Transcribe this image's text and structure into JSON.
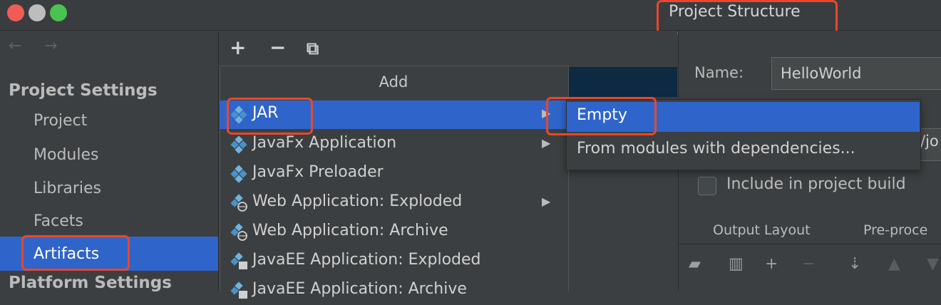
{
  "window": {
    "title": "Project Structure"
  },
  "sidebar": {
    "back_arrow": "←",
    "forward_arrow": "→",
    "project_settings_header": "Project Settings",
    "items": [
      {
        "label": "Project"
      },
      {
        "label": "Modules"
      },
      {
        "label": "Libraries"
      },
      {
        "label": "Facets"
      },
      {
        "label": "Artifacts",
        "selected": true
      }
    ],
    "platform_settings_header": "Platform Settings"
  },
  "toolbar": {
    "add": "+",
    "remove": "−",
    "copy": "⧉"
  },
  "add_menu": {
    "title": "Add",
    "items": [
      {
        "label": "JAR",
        "has_submenu": true,
        "selected": true
      },
      {
        "label": "JavaFx Application",
        "has_submenu": true
      },
      {
        "label": "JavaFx Preloader",
        "has_submenu": false
      },
      {
        "label": "Web Application: Exploded",
        "has_submenu": true
      },
      {
        "label": "Web Application: Archive",
        "has_submenu": false
      },
      {
        "label": "JavaEE Application: Exploded",
        "has_submenu": false
      },
      {
        "label": "JavaEE Application: Archive",
        "has_submenu": false
      }
    ]
  },
  "submenu": {
    "items": [
      {
        "label": "Empty",
        "selected": true
      },
      {
        "label": "From modules with dependencies..."
      }
    ]
  },
  "artifact_panel": {
    "name_label": "Name:",
    "name_value": "HelloWorld",
    "output_path_fragment": "/jo",
    "include_label": "Include in project build",
    "include_checked": false,
    "tabs": [
      "Output Layout",
      "Pre-proce"
    ]
  },
  "colors": {
    "selection": "#2f65ca",
    "highlight_border": "#e8472d",
    "background": "#3c3f41"
  }
}
